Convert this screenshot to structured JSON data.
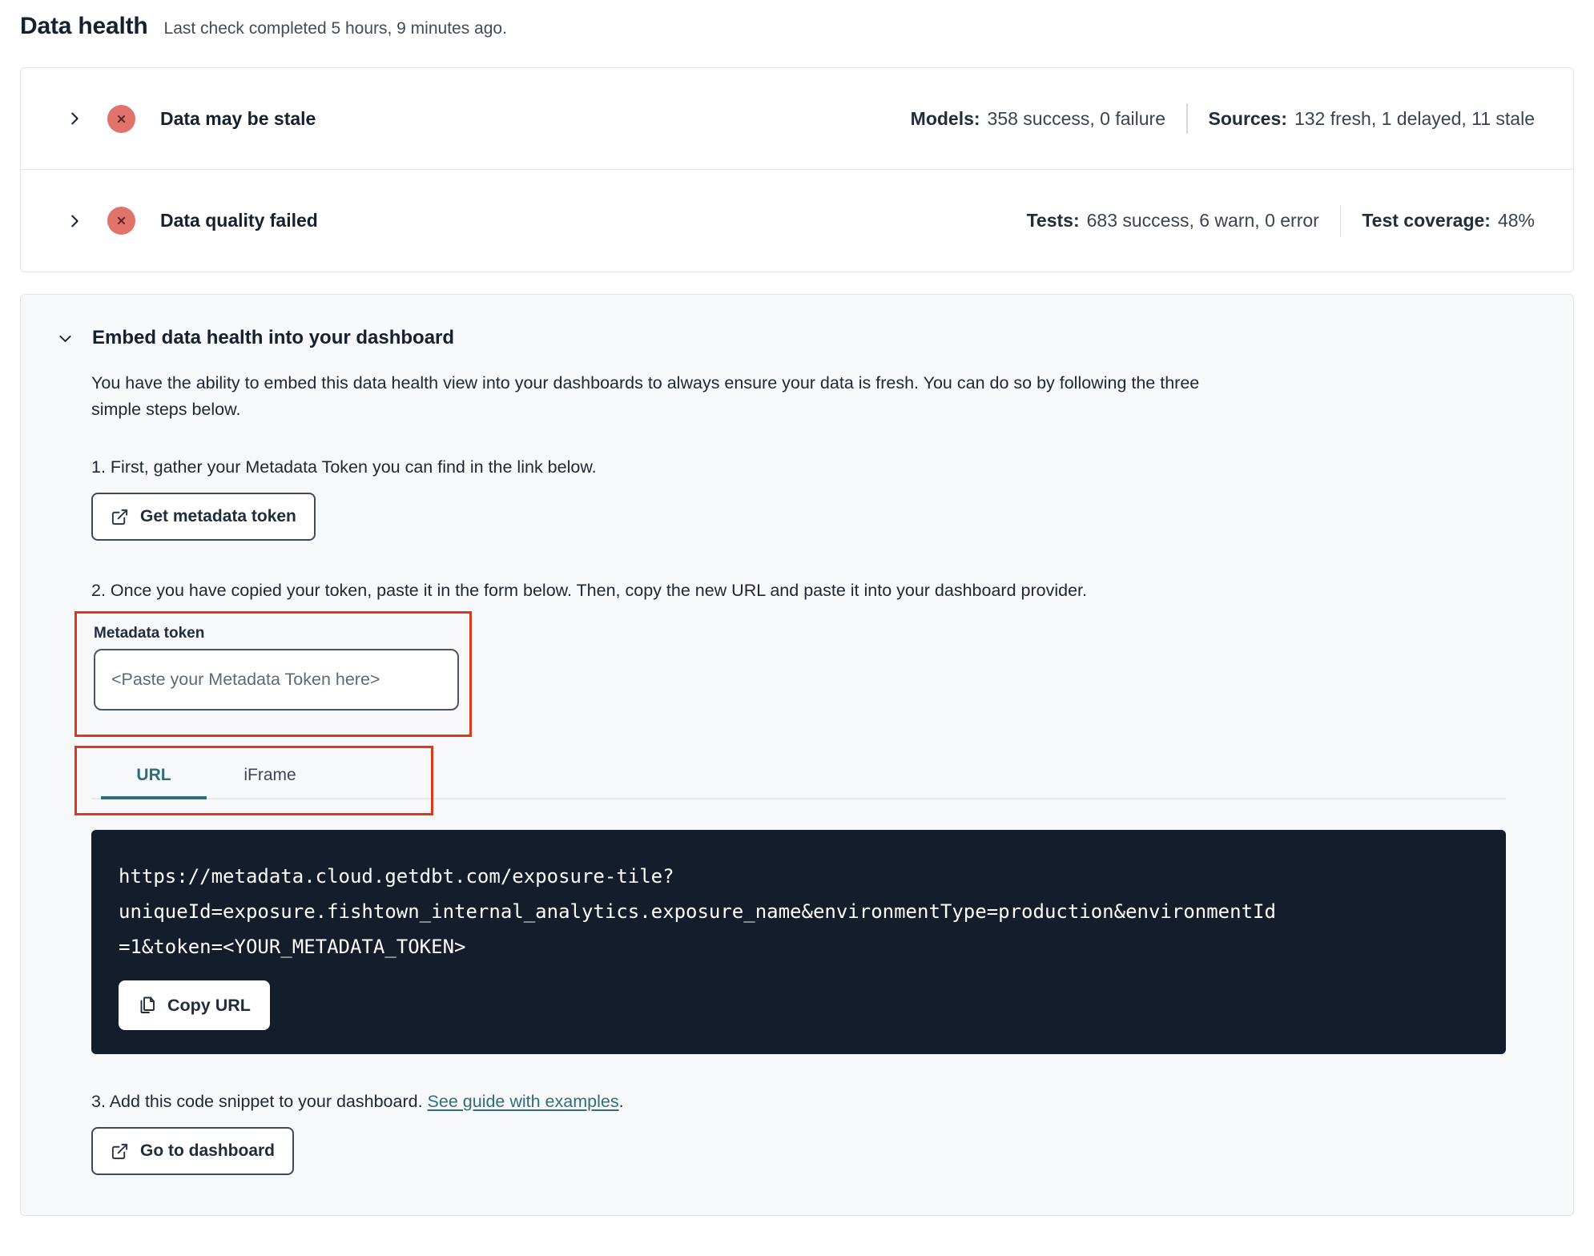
{
  "page": {
    "title": "Data health",
    "last_check": "Last check completed 5 hours, 9 minutes ago."
  },
  "status_rows": [
    {
      "title": "Data may be stale",
      "icon": "x-circle-error",
      "stats": [
        {
          "label": "Models:",
          "value": "358 success, 0 failure"
        },
        {
          "label": "Sources:",
          "value": "132 fresh, 1 delayed, 11 stale"
        }
      ]
    },
    {
      "title": "Data quality failed",
      "icon": "x-circle-error",
      "stats": [
        {
          "label": "Tests:",
          "value": "683 success, 6 warn, 0 error"
        },
        {
          "label": "Test coverage:",
          "value": "48%"
        }
      ]
    }
  ],
  "embed": {
    "title": "Embed data health into your dashboard",
    "description": "You have the ability to embed this data health view into your dashboards to always ensure your data is fresh. You can do so by following the three simple steps below.",
    "step1": "1. First, gather your Metadata Token you can find in the link below.",
    "get_token_button": "Get metadata token",
    "step2": "2. Once you have copied your token, paste it in the form below. Then, copy the new URL and paste it into your dashboard provider.",
    "token_field": {
      "label": "Metadata token",
      "placeholder": "<Paste your Metadata Token here>",
      "value": ""
    },
    "tabs": [
      {
        "label": "URL"
      },
      {
        "label": "iFrame"
      }
    ],
    "active_tab": "URL",
    "code_url_full": "https://metadata.cloud.getdbt.com/exposure-tile?uniqueId=exposure.fishtown_internal_analytics.exposure_name&environmentType=production&environmentId=1&token=<YOUR_METADATA_TOKEN>",
    "code_lines": [
      "https://metadata.cloud.getdbt.com/exposure-tile?",
      "uniqueId=exposure.fishtown_internal_analytics.exposure_name&environmentType=production&environmentId",
      "=1&token=<YOUR_METADATA_TOKEN>"
    ],
    "copy_url_button": "Copy URL",
    "step3": {
      "prefix": "3. Add this code snippet to your dashboard. ",
      "link": "See guide with examples",
      "suffix": "."
    },
    "go_to_dashboard_button": "Go to dashboard"
  },
  "icons": {
    "expand_row": "chevron-right",
    "collapse_section": "chevron-down",
    "status_error": "x-in-red-circle",
    "external_link": "box-with-arrow-out",
    "copy": "overlapping-documents"
  },
  "colors": {
    "accent_teal": "#2f6e78",
    "annotation_red": "#d93a1c",
    "error_badge": "#e0736c",
    "error_glyph": "#5c2523",
    "code_background": "#141d2b",
    "card_border": "#e3e4e8",
    "section_background": "#f7f8f9"
  }
}
